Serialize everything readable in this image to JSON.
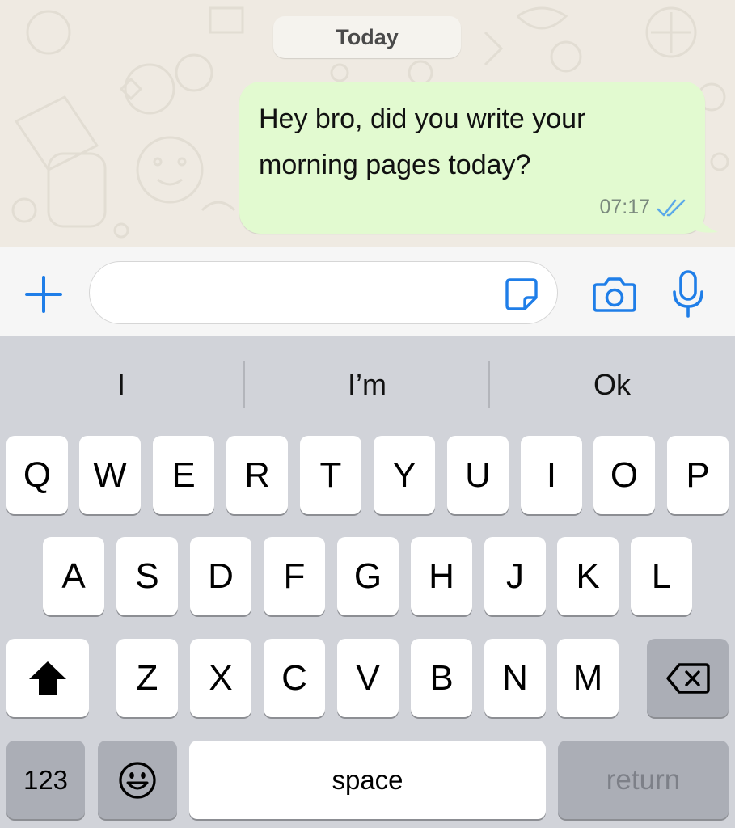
{
  "chat": {
    "date_label": "Today",
    "message": {
      "text_line1": "Hey bro, did you write your",
      "text_line2": "morning pages today?",
      "time": "07:17",
      "status_icon": "double-check-icon"
    },
    "colors": {
      "background": "#efeae2",
      "outgoing_bubble": "#e2fad0",
      "read_ticks": "#5ba9e8"
    }
  },
  "input_bar": {
    "message_value": "",
    "icons": [
      "plus-icon",
      "sticker-icon",
      "camera-icon",
      "microphone-icon"
    ],
    "accent_color": "#1f7ee8"
  },
  "keyboard": {
    "suggestions": [
      "I",
      "I’m",
      "Ok"
    ],
    "row1": [
      "Q",
      "W",
      "E",
      "R",
      "T",
      "Y",
      "U",
      "I",
      "O",
      "P"
    ],
    "row2": [
      "A",
      "S",
      "D",
      "F",
      "G",
      "H",
      "J",
      "K",
      "L"
    ],
    "row3": [
      "Z",
      "X",
      "C",
      "V",
      "B",
      "N",
      "M"
    ],
    "numbers_label": "123",
    "space_label": "space",
    "return_label": "return",
    "icons": [
      "shift-icon",
      "backspace-icon",
      "emoji-icon"
    ]
  }
}
